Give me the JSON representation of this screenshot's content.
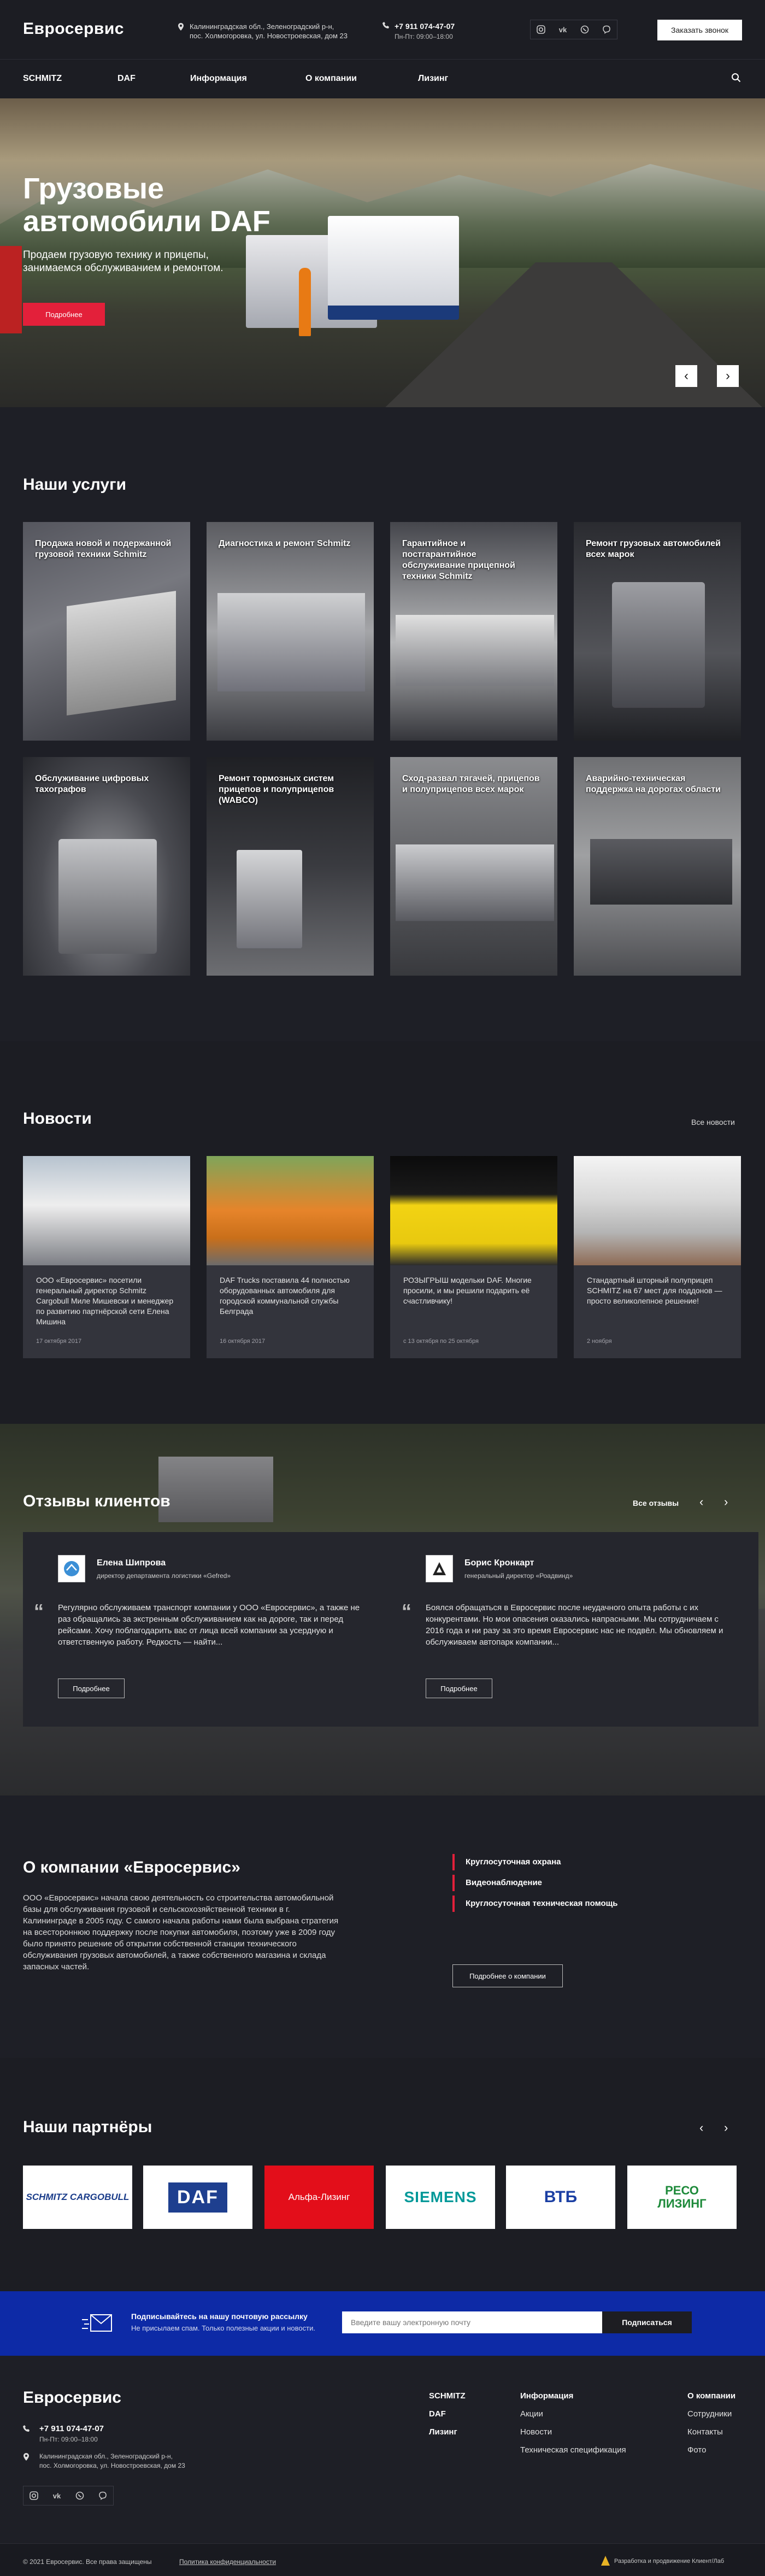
{
  "header": {
    "logo": "Евросервис",
    "address_line1": "Калининградская обл., Зеленоградский р-н,",
    "address_line2": "пос. Холмогоровка, ул. Новостроевская, дом 23",
    "phone": "+7 911 074-47-07",
    "hours": "Пн-Пт: 09:00–18:00",
    "socials": [
      "instagram-icon",
      "vk-icon",
      "whatsapp-icon",
      "viber-icon"
    ],
    "call_button": "Заказать звонок"
  },
  "nav": {
    "items": [
      "SCHMITZ",
      "DAF",
      "Информация",
      "О компании",
      "Лизинг"
    ]
  },
  "hero": {
    "title_line1": "Грузовые",
    "title_line2": "автомобили DAF",
    "subtitle": "Продаем грузовую технику и прицепы, занимаемся обслуживанием и ремонтом.",
    "button": "Подробнее",
    "prev": "‹",
    "next": "›"
  },
  "services": {
    "title": "Наши услуги",
    "items": [
      "Продажа новой и подержанной грузовой техники Schmitz",
      "Диагностика и ремонт Schmitz",
      "Гарантийное и постгарантийное обслуживание прицепной техники Schmitz",
      "Ремонт грузовых автомобилей всех марок",
      "Обслуживание цифровых тахографов",
      "Ремонт тормозных систем прицепов и полуприцепов (WABCO)",
      "Сход-развал тягачей, прицепов и полуприцепов всех марок",
      "Аварийно-техническая поддержка на дорогах области"
    ]
  },
  "news": {
    "title": "Новости",
    "all_link": "Все новости",
    "items": [
      {
        "text": "ООО «Евросервис» посетили генеральный директор Schmitz Cargobull Миле Мишевски и менеджер по развитию партнёрской сети Елена Мишина",
        "date": "17 октября 2017"
      },
      {
        "text": "DAF Trucks поставила 44 полностью оборудованных автомобиля для городской коммунальной службы Белграда",
        "date": "16 октября 2017"
      },
      {
        "text": "РОЗЫГРЫШ модельки DAF. Многие просили, и мы решили подарить её счастливчику!",
        "date": "с 13 октября по 25 октября"
      },
      {
        "text": "Стандартный шторный полуприцеп SCHMITZ на 67 мест для поддонов — просто великолепное решение!",
        "date": "2 ноября"
      }
    ]
  },
  "reviews": {
    "title": "Отзывы клиентов",
    "all_link": "Все отзывы",
    "items": [
      {
        "name": "Елена Шипрова",
        "position": "директор департамента логистики «Gefred»",
        "text": "Регулярно обслуживаем транспорт компании у ООО «Евросервис», а также не раз обращались за экстренным обслуживанием как на дороге, так и перед рейсами. Хочу поблагодарить вас от лица всей компании за усердную и ответственную работу. Редкость — найти...",
        "button": "Подробнее"
      },
      {
        "name": "Борис Кронкарт",
        "position": "генеральный директор «Роадвинд»",
        "text": "Боялся обращаться в Евросервис после неудачного опыта работы с их конкурентами. Но мои опасения оказались напрасными. Мы сотрудничаем с 2016 года и ни разу за это время Евросервис нас не подвёл. Мы обновляем и обслуживаем автопарк компании...",
        "button": "Подробнее"
      }
    ]
  },
  "about": {
    "title": "О компании «Евросервис»",
    "text": "ООО «Евросервис» начала свою деятельность со строительства автомобильной базы для обслуживания грузовой и сельскохозяйственной техники в г. Калининграде в 2005 году. С самого начала работы нами была выбрана стратегия на всестороннюю поддержку после покупки автомобиля, поэтому уже в 2009 году было принято решение об открытии собственной станции технического обслуживания грузовых автомобилей, а также собственного магазина и склада запасных частей.",
    "features": [
      "Круглосуточная охрана",
      "Видеонаблюдение",
      "Круглосуточная техническая помощь"
    ],
    "button": "Подробнее о компании"
  },
  "partners": {
    "title": "Наши партнёры",
    "items": [
      "SCHMITZ CARGOBULL",
      "DAF",
      "Альфа-Лизинг",
      "SIEMENS",
      "ВТБ",
      "РЕСО ЛИЗИНГ"
    ]
  },
  "subscribe": {
    "title": "Подписывайтесь на нашу почтовую рассылку",
    "subtitle": "Не присылаем спам. Только полезные акции и новости.",
    "placeholder": "Введите вашу электронную почту",
    "button": "Подписаться"
  },
  "footer": {
    "logo": "Евросервис",
    "phone": "+7 911 074-47-07",
    "hours": "Пн-Пт: 09:00–18:00",
    "address_line1": "Калининградская обл., Зеленоградский р-н,",
    "address_line2": "пос. Холмогоровка, ул. Новостроевская, дом 23",
    "col1": [
      "SCHMITZ",
      "DAF",
      "Лизинг"
    ],
    "col2_title": "Информация",
    "col2": [
      "Акции",
      "Новости",
      "Техническая спецификация"
    ],
    "col3_title": "О компании",
    "col3": [
      "Сотрудники",
      "Контакты",
      "Фото"
    ],
    "copyright": "© 2021 Евросервис. Все права защищены",
    "privacy": "Политика конфиденциальности",
    "dev": "Разработка и продвижение Клиент/Лаб"
  },
  "colors": {
    "accent": "#e3203a",
    "dark": "#1e1f26",
    "subscribe_bg": "#0d2aa6"
  }
}
